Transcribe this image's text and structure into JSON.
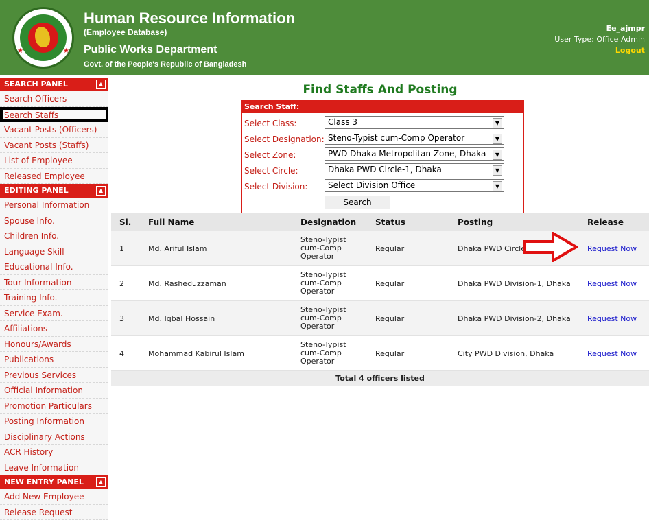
{
  "header": {
    "title": "Human Resource Information",
    "subtitle": "(Employee Database)",
    "department": "Public Works Department",
    "government": "Govt. of the People's Republic of Bangladesh",
    "username": "Ee_ajmpr",
    "user_type": "User Type: Office Admin",
    "logout": "Logout"
  },
  "sidebar": {
    "panels": [
      {
        "title": "SEARCH PANEL",
        "items": [
          "Search Officers",
          "Search Staffs",
          "Vacant Posts (Officers)",
          "Vacant Posts (Staffs)",
          "List of Employee",
          "Released Employee"
        ]
      },
      {
        "title": "EDITING PANEL",
        "items": [
          "Personal Information",
          "Spouse Info.",
          "Children Info.",
          "Language Skill",
          "Educational Info.",
          "Tour Information",
          "Training Info.",
          "Service Exam.",
          "Affiliations",
          "Honours/Awards",
          "Publications",
          "Previous Services",
          "Official Information",
          "Promotion Particulars",
          "Posting Information",
          "Disciplinary Actions",
          "ACR History",
          "Leave Information"
        ]
      },
      {
        "title": "NEW ENTRY PANEL",
        "items": [
          "Add New Employee",
          "Release Request"
        ]
      }
    ],
    "active_item": "Search Staffs"
  },
  "page": {
    "title": "Find Staffs And Posting"
  },
  "search": {
    "heading": "Search Staff:",
    "fields": [
      {
        "label": "Select Class:",
        "value": "Class 3"
      },
      {
        "label": "Select Designation:",
        "value": "Steno-Typist cum-Comp Operator"
      },
      {
        "label": "Select Zone:",
        "value": "PWD Dhaka Metropolitan Zone, Dhaka"
      },
      {
        "label": "Select Circle:",
        "value": "Dhaka PWD Circle-1, Dhaka"
      },
      {
        "label": "Select Division:",
        "value": "Select Division Office"
      }
    ],
    "button": "Search"
  },
  "table": {
    "columns": [
      "Sl.",
      "Full Name",
      "Designation",
      "Status",
      "Posting",
      "Release"
    ],
    "rows": [
      {
        "sl": "1",
        "name": "Md. Ariful Islam",
        "designation": [
          "Steno-Typist",
          "cum-Comp",
          "Operator"
        ],
        "status": "Regular",
        "posting": "Dhaka PWD Circle-1, Dhaka",
        "release": "Request Now"
      },
      {
        "sl": "2",
        "name": "Md. Rasheduzzaman",
        "designation": [
          "Steno-Typist",
          "cum-Comp",
          "Operator"
        ],
        "status": "Regular",
        "posting": "Dhaka PWD Division-1, Dhaka",
        "release": "Request Now"
      },
      {
        "sl": "3",
        "name": "Md. Iqbal Hossain",
        "designation": [
          "Steno-Typist",
          "cum-Comp",
          "Operator"
        ],
        "status": "Regular",
        "posting": "Dhaka PWD Division-2, Dhaka",
        "release": "Request Now"
      },
      {
        "sl": "4",
        "name": "Mohammad Kabirul Islam",
        "designation": [
          "Steno-Typist",
          "cum-Comp",
          "Operator"
        ],
        "status": "Regular",
        "posting": "City PWD Division, Dhaka",
        "release": "Request Now"
      }
    ],
    "total": "Total 4 officers listed"
  },
  "colors": {
    "header_bg": "#4e8c3a",
    "accent_red": "#d91e18",
    "title_green": "#1f7a1f",
    "link_blue": "#1a1acc"
  }
}
